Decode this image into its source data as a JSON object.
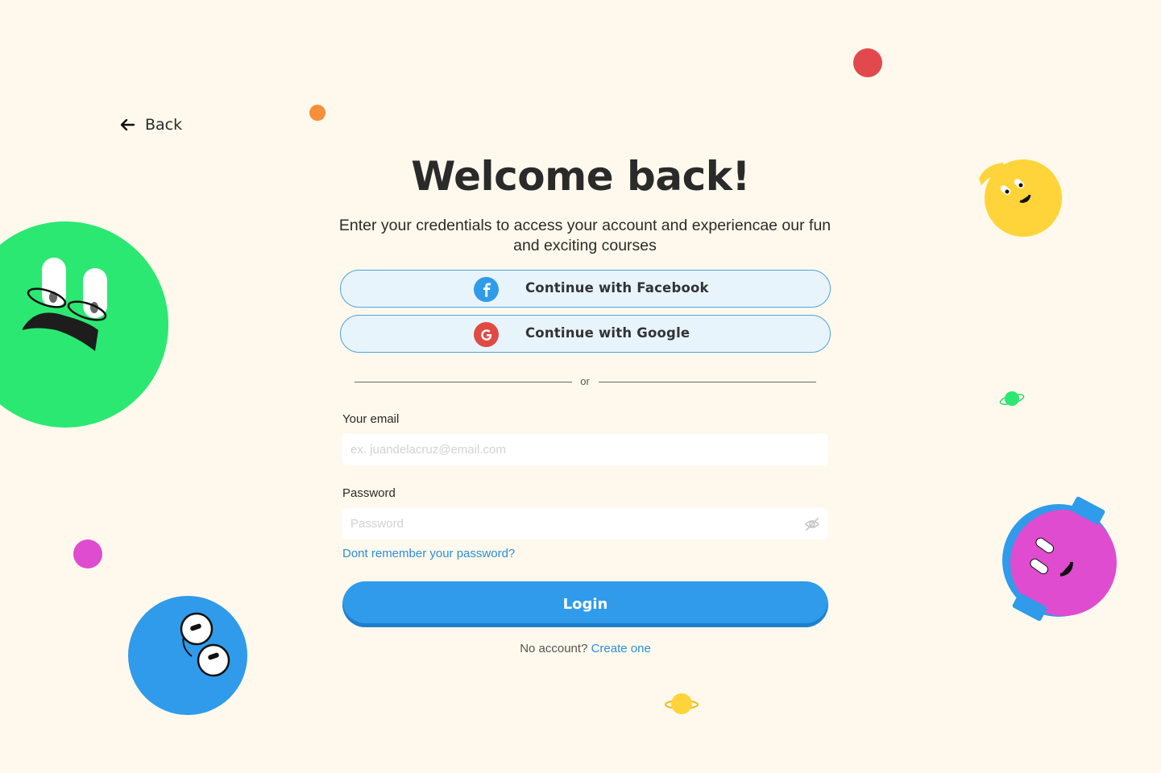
{
  "nav": {
    "back_label": "Back"
  },
  "header": {
    "title": "Welcome back!",
    "subtitle_line1": "Enter your credentials to access your account and experiencae our fun",
    "subtitle_line2": "and exciting courses"
  },
  "social": {
    "facebook_label": "Continue with Facebook",
    "google_label": "Continue with Google"
  },
  "divider": {
    "text": "or"
  },
  "form": {
    "email_label": "Your email",
    "email_placeholder": "ex. juandelacruz@email.com",
    "password_label": "Password",
    "password_placeholder": "Password",
    "forgot_label": "Dont remember your password?",
    "login_label": "Login",
    "no_account_text": "No account?",
    "create_label": "Create one"
  },
  "icons": {
    "back": "arrow-left-icon",
    "facebook": "facebook-icon",
    "google": "google-icon",
    "password_toggle": "eye-off-icon"
  },
  "colors": {
    "background": "#fef9ec",
    "primary": "#2f9bea",
    "link": "#2d8ed9",
    "facebook": "#2f9bea",
    "google": "#e04a43",
    "green": "#2be872",
    "yellow": "#ffd43a",
    "magenta": "#e04ccf",
    "red": "#e3494c",
    "orange": "#f88d3a"
  }
}
